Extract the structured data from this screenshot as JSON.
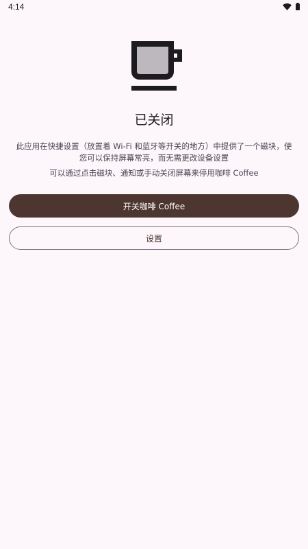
{
  "status_bar": {
    "time": "4:14",
    "icons": [
      "wifi-icon",
      "battery-icon"
    ]
  },
  "main": {
    "icon": "coffee-cup-icon",
    "status_title": "已关闭",
    "description": "此应用在快捷设置（放置着 Wi-Fi 和蓝牙等开关的地方）中提供了一个磁块，使您可以保持屏幕常亮，而无需更改设备设置",
    "hint": "可以通过点击磁块、通知或手动关闭屏幕来停用咖啡 Coffee",
    "toggle_label": "开关咖啡 Coffee",
    "settings_label": "设置"
  },
  "colors": {
    "background": "#FDF7FC",
    "primary": "#4E3630",
    "cup_outline": "#1D1B1E",
    "cup_fill": "#BDB8BD"
  }
}
